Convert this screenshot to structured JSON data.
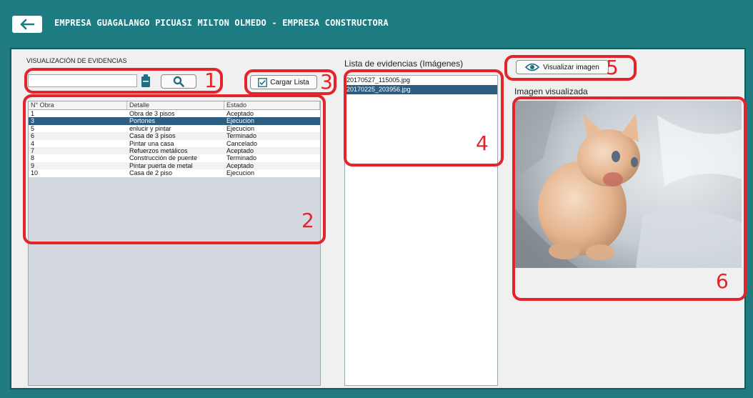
{
  "header": {
    "title": "EMPRESA GUAGALANGO PICUASI MILTON OLMEDO - EMPRESA CONSTRUCTORA",
    "back_icon": "arrow-left-icon"
  },
  "left": {
    "section_title": "VISUALIZACIÓN DE EVIDENCIAS",
    "search_value": "",
    "cargar_label": "Cargar Lista",
    "columns": [
      "N° Obra",
      "Detalle",
      "Estado"
    ],
    "rows": [
      {
        "n": "1",
        "detalle": "Obra de 3 pisos",
        "estado": "Aceptado"
      },
      {
        "n": "3",
        "detalle": "Portones",
        "estado": "Ejecucion"
      },
      {
        "n": "5",
        "detalle": "enlucir y pintar",
        "estado": "Ejecucion"
      },
      {
        "n": "6",
        "detalle": "Casa de 3 pisos",
        "estado": "Terminado"
      },
      {
        "n": "4",
        "detalle": "Pintar una casa",
        "estado": "Cancelado"
      },
      {
        "n": "7",
        "detalle": "Refuerzos metálicos",
        "estado": "Aceptado"
      },
      {
        "n": "8",
        "detalle": "Construcción de puente",
        "estado": "Terminado"
      },
      {
        "n": "9",
        "detalle": "Pintar puerta de metal",
        "estado": "Aceptado"
      },
      {
        "n": "10",
        "detalle": "Casa de 2 piso",
        "estado": "Ejecucion"
      }
    ]
  },
  "middle": {
    "title": "Lista de evidencias (Imágenes)",
    "files": [
      "20170527_115005.jpg",
      "20170225_203956.jpg"
    ]
  },
  "right": {
    "visualizar_label": "Visualizar imagen",
    "image_title": "Imagen visualizada"
  },
  "annotations": [
    "1",
    "2",
    "3",
    "4",
    "5",
    "6"
  ],
  "colors": {
    "header": "#1d7c82",
    "selection": "#2d5d80",
    "annotation": "#e3242b"
  }
}
